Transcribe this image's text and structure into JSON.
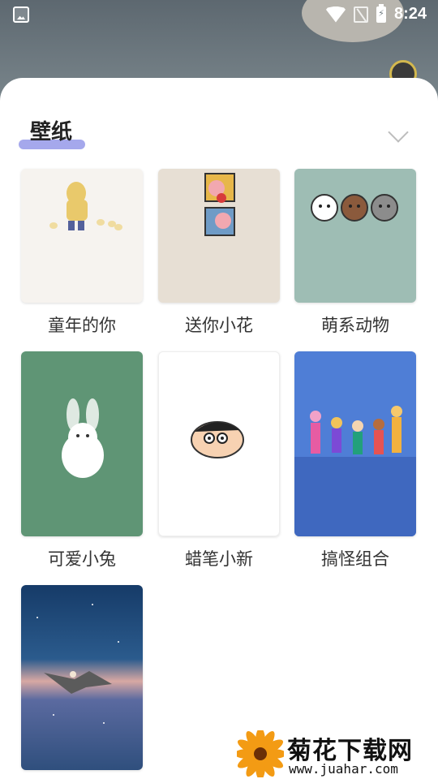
{
  "status": {
    "time": "8:24"
  },
  "sheet": {
    "title": "壁纸"
  },
  "wallpapers": [
    {
      "label": "童年的你",
      "bg": "#f6f3ef"
    },
    {
      "label": "送你小花",
      "bg": "#e7dfd4"
    },
    {
      "label": "萌系动物",
      "bg": "#9ebdb4"
    },
    {
      "label": "可爱小兔",
      "bg": "#5f9575"
    },
    {
      "label": "蜡笔小新",
      "bg": "#ffffff"
    },
    {
      "label": "搞怪组合",
      "bg": "#4f7ed6"
    },
    {
      "label": "",
      "bg": "#2c4f7d"
    }
  ],
  "watermark": {
    "title": "菊花下载网",
    "url": "www.juahar.com"
  },
  "colors": {
    "accent_underline": "#a5a8ec",
    "sheet_bg": "#ffffff"
  }
}
